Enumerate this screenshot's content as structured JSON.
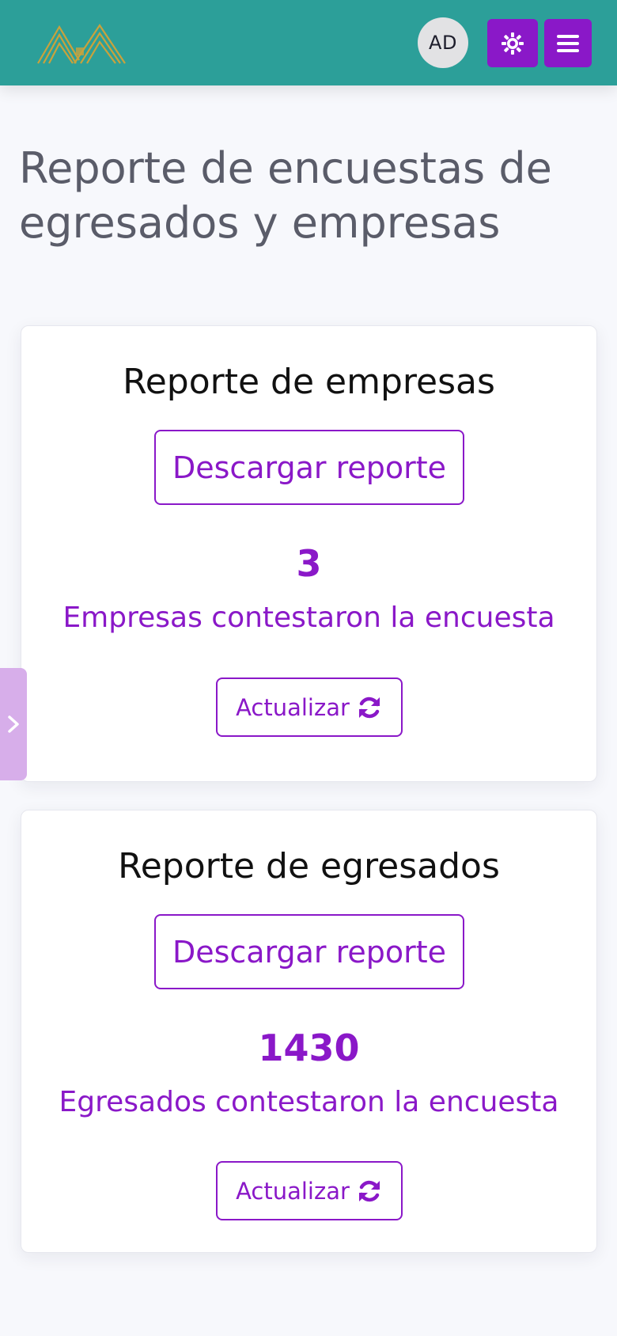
{
  "header": {
    "logo_icon": "chevron-logo-icon",
    "avatar_initials": "AD",
    "theme_icon": "sun-gear-icon",
    "menu_icon": "hamburger-menu-icon"
  },
  "page": {
    "title": "Reporte de encuestas de egresados y empresas"
  },
  "cards": [
    {
      "title": "Reporte de empresas",
      "download_label": "Descargar reporte",
      "count": "3",
      "count_label": "Empresas contestaron la encuesta",
      "refresh_label": "Actualizar",
      "refresh_icon": "sync-icon"
    },
    {
      "title": "Reporte de egresados",
      "download_label": "Descargar reporte",
      "count": "1430",
      "count_label": "Egresados contestaron la encuesta",
      "refresh_label": "Actualizar",
      "refresh_icon": "sync-icon"
    }
  ],
  "sidebar_toggle": {
    "icon": "chevron-right-icon"
  },
  "colors": {
    "navbar": "#2c9f99",
    "accent": "#8a18c8",
    "logo_gold": "#c9a23c",
    "background": "#f7f8fc"
  }
}
